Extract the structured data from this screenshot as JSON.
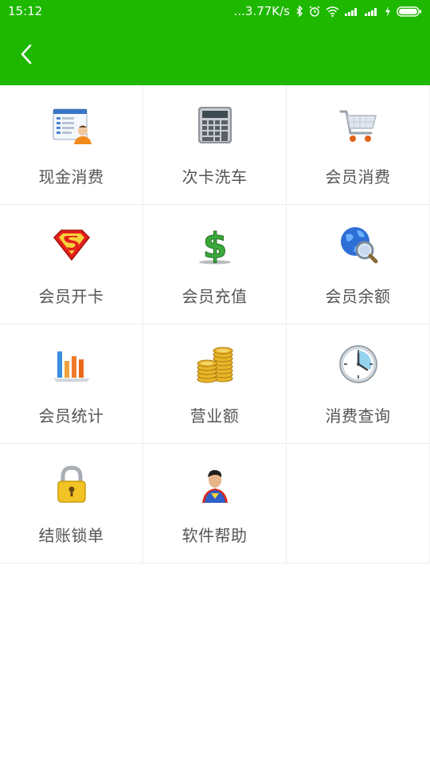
{
  "status_bar": {
    "time": "15:12",
    "network_speed": "...3.77K/s",
    "icons": [
      "bluetooth-icon",
      "alarm-icon",
      "wifi-icon",
      "signal-icon",
      "signal-icon",
      "charging-icon",
      "battery-icon"
    ]
  },
  "app_bar": {
    "back_icon": "chevron-left-icon",
    "background": "#1fb800"
  },
  "menu": {
    "items": [
      {
        "label": "现金消费",
        "icon": "cash-register-form-icon"
      },
      {
        "label": "次卡洗车",
        "icon": "calculator-icon"
      },
      {
        "label": "会员消费",
        "icon": "shopping-cart-icon"
      },
      {
        "label": "会员开卡",
        "icon": "superman-shield-icon"
      },
      {
        "label": "会员充值",
        "icon": "dollar-sign-icon"
      },
      {
        "label": "会员余额",
        "icon": "globe-magnifier-icon"
      },
      {
        "label": "会员统计",
        "icon": "bar-chart-icon"
      },
      {
        "label": "营业额",
        "icon": "coin-stacks-icon"
      },
      {
        "label": "消费查询",
        "icon": "clock-icon"
      },
      {
        "label": "结账锁单",
        "icon": "padlock-icon"
      },
      {
        "label": "软件帮助",
        "icon": "superman-avatar-icon"
      }
    ]
  }
}
